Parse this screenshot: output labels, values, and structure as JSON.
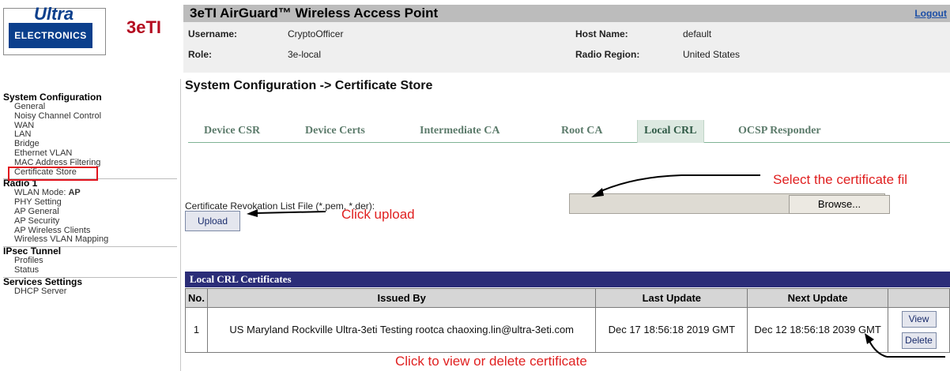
{
  "brand": {
    "ultra": "Ultra",
    "electronics": "ELECTRONICS",
    "company": "3eTI"
  },
  "header": {
    "title": "3eTI AirGuard™ Wireless Access Point",
    "logout": "Logout",
    "username_label": "Username:",
    "username": "CryptoOfficer",
    "role_label": "Role:",
    "role": "3e-local",
    "host_label": "Host Name:",
    "host": "default",
    "region_label": "Radio Region:",
    "region": "United States"
  },
  "sidebar": {
    "sections": [
      {
        "title": "System Configuration",
        "items": [
          "General",
          "Noisy Channel Control",
          "WAN",
          "LAN",
          "Bridge",
          "Ethernet VLAN",
          "MAC Address Filtering",
          "Certificate Store"
        ]
      },
      {
        "title": "Radio 1",
        "items": [
          "WLAN Mode: AP",
          "PHY Setting",
          "AP General",
          "AP Security",
          "AP Wireless Clients",
          "Wireless VLAN Mapping"
        ]
      },
      {
        "title": "IPsec Tunnel",
        "items": [
          "Profiles",
          "Status"
        ]
      },
      {
        "title": "Services Settings",
        "items": [
          "DHCP Server"
        ]
      }
    ],
    "highlighted": "Certificate Store"
  },
  "main": {
    "page_title": "System Configuration -> Certificate Store",
    "tabs": [
      "Device CSR",
      "Device Certs",
      "Intermediate CA",
      "Root CA",
      "Local CRL",
      "OCSP Responder"
    ],
    "active_tab": "Local CRL",
    "crl_label": "Certificate Revokation List File (*.pem, *.der):",
    "browse": "Browse...",
    "upload": "Upload",
    "annot_select": "Select the certificate fil",
    "annot_upload": "Click upload",
    "annot_view_delete": "Click to view or delete certificate",
    "table": {
      "title": "Local CRL Certificates",
      "headers": [
        "No.",
        "Issued By",
        "Last Update",
        "Next Update",
        ""
      ],
      "rows": [
        {
          "no": "1",
          "issued_by": "US Maryland Rockville Ultra-3eti Testing rootca chaoxing.lin@ultra-3eti.com",
          "last_update": "Dec 17 18:56:18 2019 GMT",
          "next_update": "Dec 12 18:56:18 2039 GMT",
          "view": "View",
          "delete": "Delete"
        }
      ]
    }
  },
  "colors": {
    "title_bar": "#bcbcbc",
    "table_header": "#2b2d78",
    "annotation": "#e02020",
    "highlight_box": "#e0141e"
  }
}
